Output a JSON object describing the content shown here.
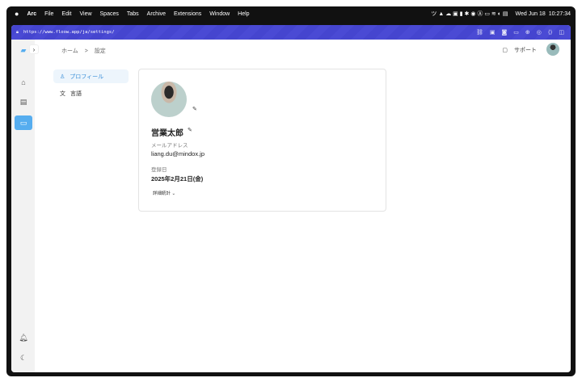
{
  "menubar": {
    "apple": "",
    "app": "Arc",
    "items": [
      "File",
      "Edit",
      "View",
      "Spaces",
      "Tabs",
      "Archive",
      "Extensions",
      "Window",
      "Help"
    ],
    "date": "Wed Jun 18",
    "time": "10:27:34"
  },
  "browser": {
    "url": "https://www.floow.app/ja/settings/"
  },
  "breadcrumb": {
    "home": "ホーム",
    "sep": ">",
    "current": "設定"
  },
  "header": {
    "support": "サポート"
  },
  "nav": {
    "profile": "プロフィール",
    "language": "言語"
  },
  "profile": {
    "name": "営業太郎",
    "email_label": "メールアドレス",
    "email": "liang.du@mindox.jp",
    "reg_label": "登録日",
    "reg_date": "2025年2月21日(金)",
    "details": "詳細統計"
  },
  "colors": {
    "accent": "#56adef",
    "urlbar": "#4545cf"
  }
}
